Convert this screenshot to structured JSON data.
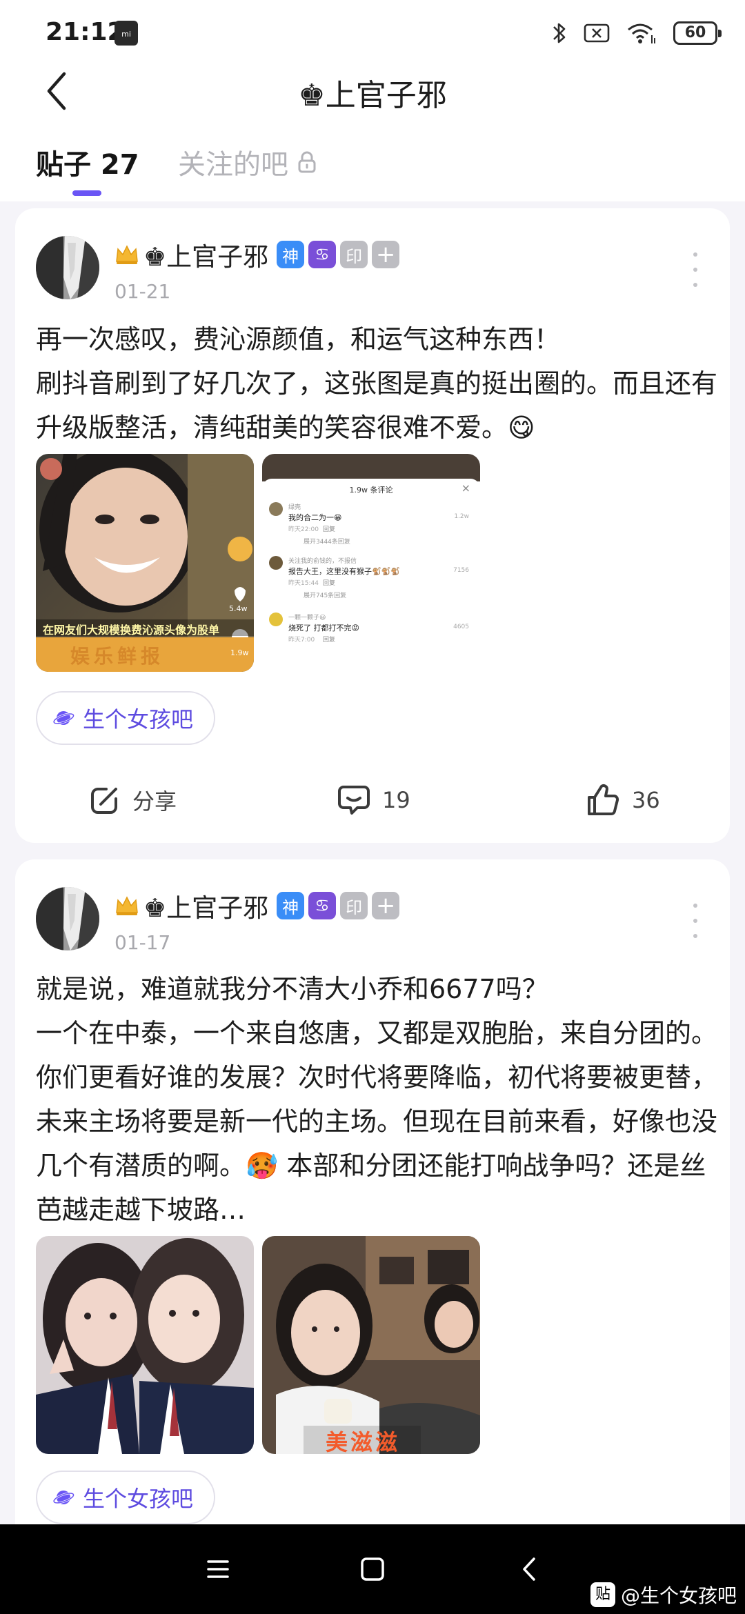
{
  "status_bar": {
    "time": "21:12",
    "mi_label": "mi",
    "battery": "60"
  },
  "nav": {
    "title": "♚上官子邪"
  },
  "tabs": {
    "posts_label": "贴子 27",
    "follow_label": "关注的吧"
  },
  "posts": [
    {
      "author": "♚上官子邪",
      "badges": [
        "神",
        "♋",
        "印",
        "+"
      ],
      "date": "01-21",
      "text": "再一次感叹，费沁源颜值，和运气这种东西！\n刷抖音刷到了好几次了，这张图是真的挺出圈的。而且还有升级版整活，清纯甜美的笑容很难不爱。😋",
      "bar_name": "生个女孩吧",
      "share_label": "分享",
      "comments": "19",
      "likes": "36",
      "image1": {
        "caption": "在网友们大规模换费沁源头像为股单",
        "side_count_1": "5.4w",
        "side_count_2": "1.9w",
        "logo": "娱乐鲜报"
      },
      "image2": {
        "header": "1.9w 条评论",
        "comments": [
          {
            "user": "绿壳",
            "text": "我的合二为一😁",
            "time": "昨天22:00",
            "reply": "回复",
            "likes": "1.2w",
            "expand": "展开3444条回复"
          },
          {
            "user": "关注我的俞钱的，不报信",
            "text": "报告大王，这里没有猴子🐒🐒🐒",
            "time": "昨天15:44",
            "reply": "回复",
            "likes": "7156",
            "expand": "展开745条回复"
          },
          {
            "user": "一颗一颗子😃",
            "text": "烧死了 打都打不完😡",
            "time": "昨天7:00",
            "reply": "回复",
            "likes": "4605",
            "expand": ""
          }
        ]
      }
    },
    {
      "author": "♚上官子邪",
      "badges": [
        "神",
        "♋",
        "印",
        "+"
      ],
      "date": "01-17",
      "text": "就是说，难道就我分不清大小乔和6677吗？\n一个在中泰，一个来自悠唐，又都是双胞胎，来自分团的。你们更看好谁的发展？次时代将要降临，初代将要被更替，未来主场将要是新一代的主场。但现在目前来看，好像也没几个有潜质的啊。🥵 本部和分团还能打响战争吗？还是丝芭越走越下坡路…",
      "bar_name": "生个女孩吧",
      "image2": {
        "caption": "美滋滋"
      }
    }
  ],
  "watermark": {
    "icon": "贴",
    "text": "@生个女孩吧"
  },
  "colors": {
    "accent": "#6a55f5",
    "badge_blue": "#3a8df7",
    "badge_purple": "#7a4fd8"
  }
}
